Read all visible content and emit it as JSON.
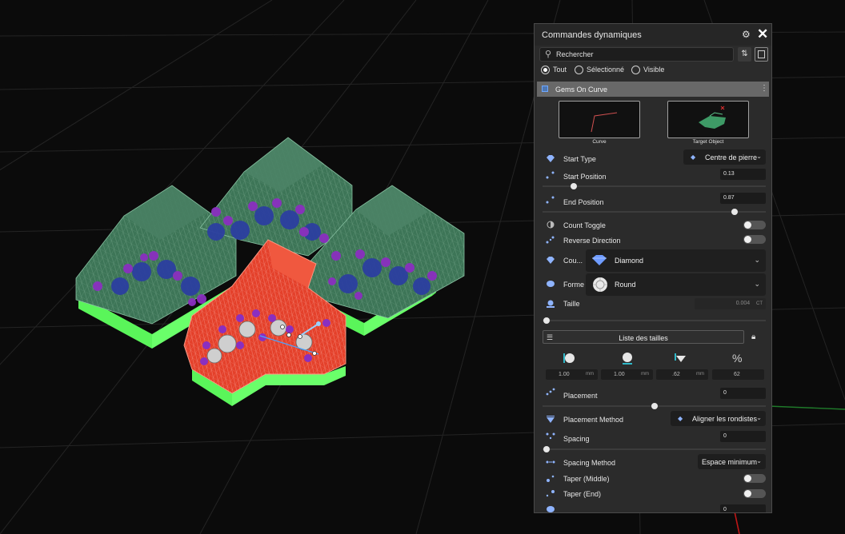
{
  "panel": {
    "title": "Commandes dynamiques",
    "search_placeholder": "Rechercher",
    "filters": [
      "Tout",
      "Sélectionné",
      "Visible"
    ],
    "selected_filter": "Tout",
    "section_title": "Gems On Curve",
    "thumbs": {
      "curve": "Curve",
      "target": "Target Object"
    },
    "start_type": {
      "label": "Start Type",
      "value": "Centre de pierre"
    },
    "start_position": {
      "label": "Start Position",
      "value": "0.13",
      "level": 0.13
    },
    "end_position": {
      "label": "End Position",
      "value": "0.87",
      "level": 0.87
    },
    "count_toggle": "Count Toggle",
    "reverse_direction": "Reverse Direction",
    "cut": {
      "label": "Cou...",
      "value": "Diamond"
    },
    "shape": {
      "label": "Forme",
      "value": "Round"
    },
    "size": {
      "label": "Taille",
      "value": "0.004",
      "unit": "CT"
    },
    "sizes_list": "Liste des tailles",
    "dims": [
      {
        "value": "1.00",
        "unit": "mm"
      },
      {
        "value": "1.00",
        "unit": "mm"
      },
      {
        "value": ".62",
        "unit": "mm"
      },
      {
        "value": "62",
        "unit": ""
      }
    ],
    "pct_symbol": "%",
    "placement": {
      "label": "Placement",
      "value": "0",
      "level": 0.5
    },
    "placement_method": {
      "label": "Placement Method",
      "value": "Aligner les rondistes"
    },
    "spacing": {
      "label": "Spacing",
      "value": "0"
    },
    "spacing_method": {
      "label": "Spacing Method",
      "value": "Espace minimum"
    },
    "taper_middle": "Taper (Middle)",
    "taper_end": "Taper (End)",
    "partial_value": "0"
  },
  "colors": {
    "panel_bg": "#2b2b2b",
    "section_bg": "#686868",
    "shell_green": "#3f7a5a",
    "base_green": "#66ff66",
    "selected_red": "#e4402a",
    "gem_blue": "#2c3fa0",
    "prong_purple": "#8a2fc0"
  }
}
